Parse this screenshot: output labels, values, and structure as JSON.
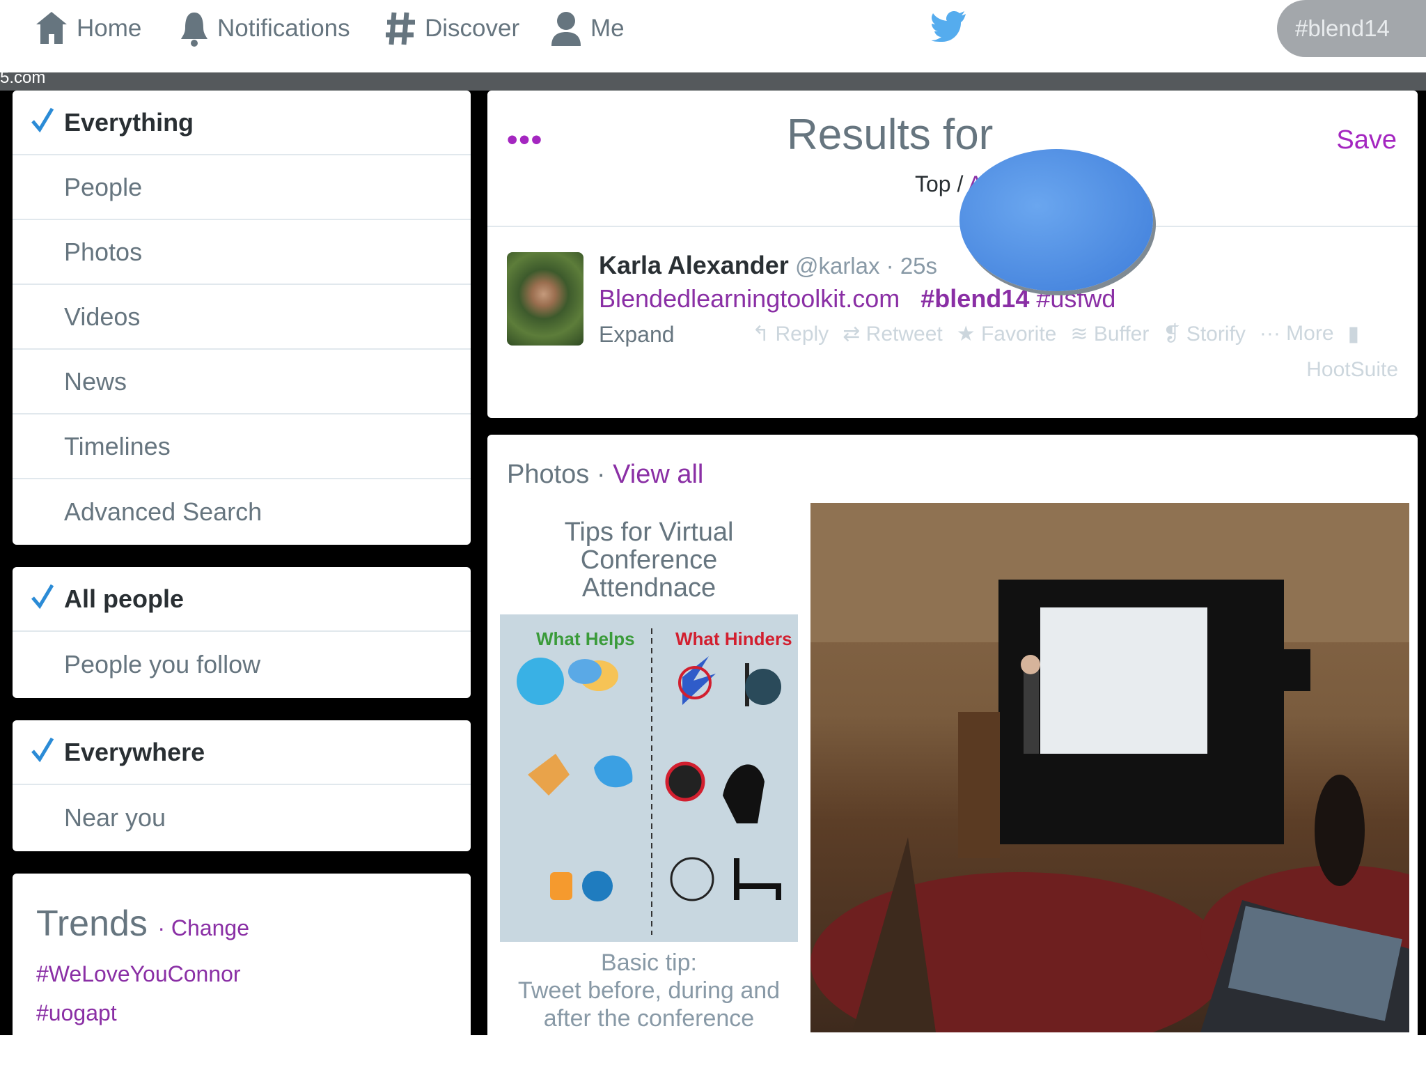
{
  "nav": {
    "home": "Home",
    "notifications": "Notifications",
    "discover": "Discover",
    "me": "Me",
    "search_value": "#blend14"
  },
  "url_fragment": "5.com",
  "filters": {
    "content": [
      {
        "label": "Everything",
        "selected": true
      },
      {
        "label": "People",
        "selected": false
      },
      {
        "label": "Photos",
        "selected": false
      },
      {
        "label": "Videos",
        "selected": false
      },
      {
        "label": "News",
        "selected": false
      },
      {
        "label": "Timelines",
        "selected": false
      },
      {
        "label": "Advanced Search",
        "selected": false
      }
    ],
    "people": [
      {
        "label": "All people",
        "selected": true
      },
      {
        "label": "People you follow",
        "selected": false
      }
    ],
    "location": [
      {
        "label": "Everywhere",
        "selected": true
      },
      {
        "label": "Near you",
        "selected": false
      }
    ]
  },
  "trends": {
    "title": "Trends",
    "change": "· Change",
    "items": [
      "#WeLoveYouConnor",
      "#uogapt"
    ]
  },
  "results": {
    "dots": "•••",
    "title": "Results for",
    "top": "Top",
    "sep": " / ",
    "all": "All",
    "save": "Save"
  },
  "tweet": {
    "name": "Karla Alexander",
    "meta": " @karlax · 25s",
    "link": "Blendedlearningtoolkit.com",
    "tag1": "#blend14",
    "tag2": "#usfwd",
    "expand": "Expand",
    "actions": [
      "Reply",
      "Retweet",
      "Favorite",
      "Buffer",
      "Storify",
      "More"
    ],
    "hootsuite": "HootSuite"
  },
  "photos": {
    "label": "Photos",
    "sep": " · ",
    "view_all": "View all",
    "infographic": {
      "title_lines": [
        "Tips for Virtual",
        "Conference",
        "Attendnace"
      ],
      "helps": "What Helps",
      "hinders": "What Hinders",
      "tip_lines": [
        "Basic tip:",
        "Tweet before, during and",
        "after the conference"
      ]
    }
  },
  "colors": {
    "accent": "#8a2fa5",
    "twitter_blue": "#55acee",
    "check": "#2b8bd6"
  }
}
